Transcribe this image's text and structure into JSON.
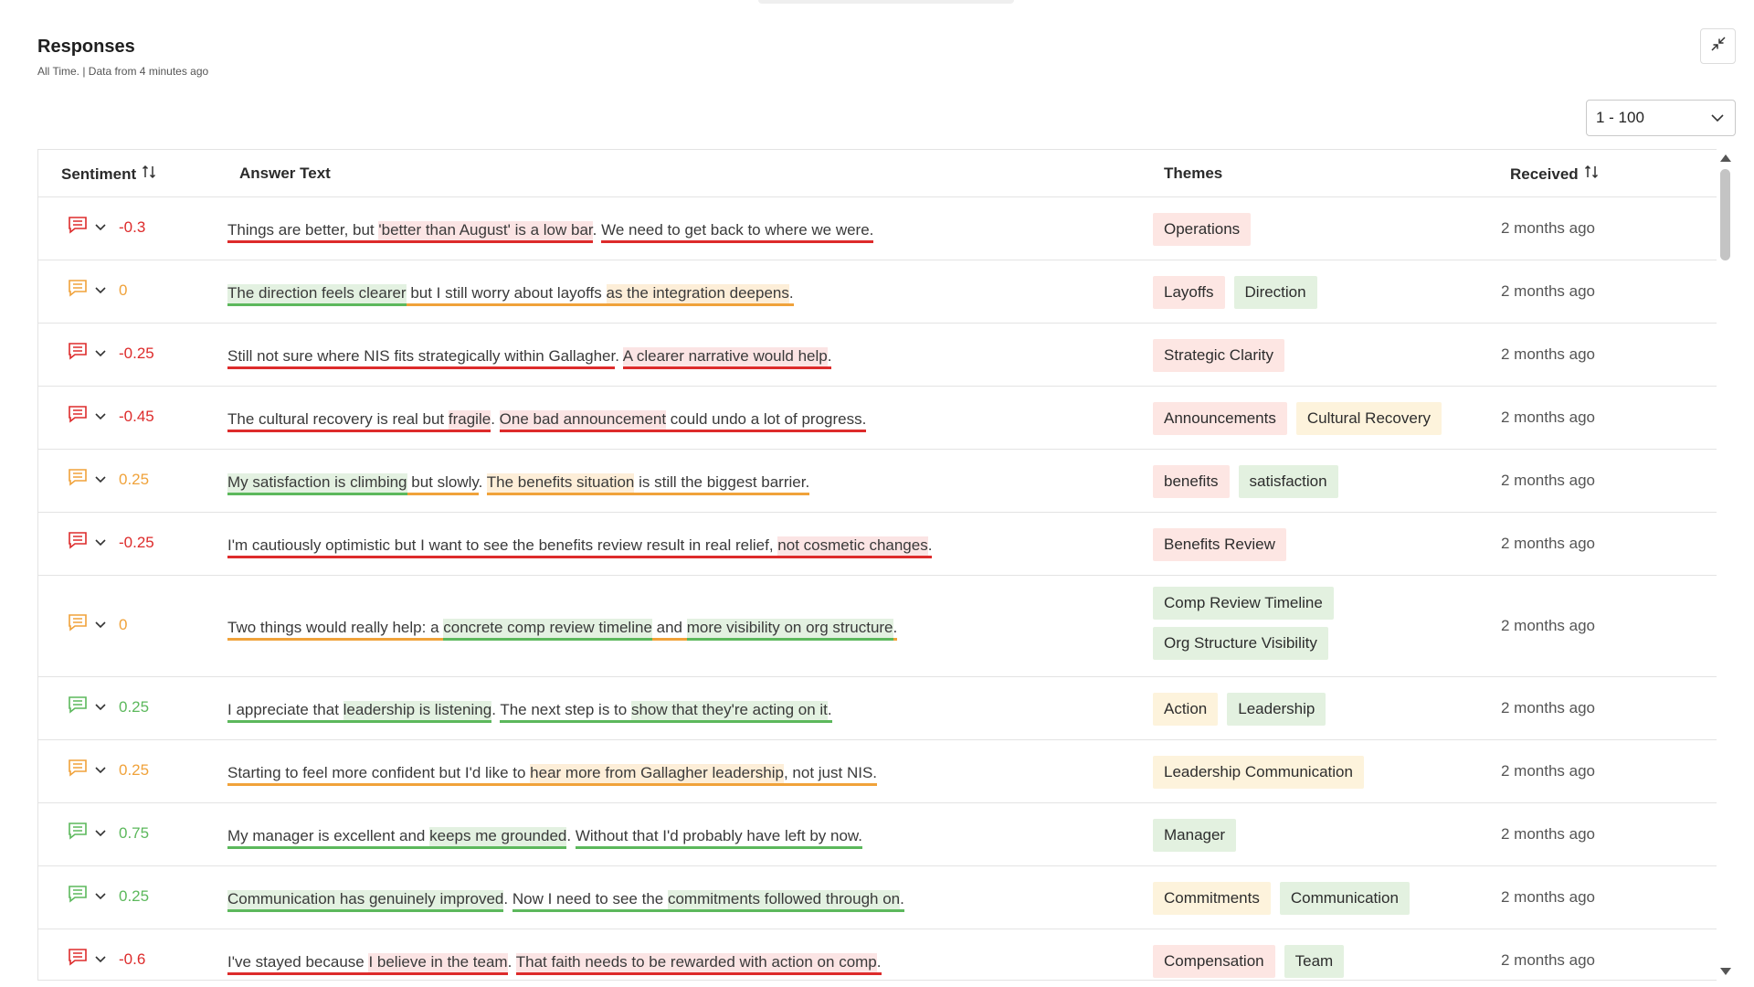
{
  "header": {
    "title": "Responses",
    "subtitle": "All Time. | Data from 4 minutes ago",
    "collapse_icon": "collapse-arrows-icon"
  },
  "pagination": {
    "selected": "1 - 100"
  },
  "colors": {
    "negative": "#dd2b2b",
    "positive": "#5cb85c",
    "neutral": "#f0a23a"
  },
  "columns": {
    "sentiment": "Sentiment",
    "answer": "Answer Text",
    "themes": "Themes",
    "received": "Received"
  },
  "rows": [
    {
      "score": "-0.3",
      "tone": "neg",
      "segments": [
        {
          "text": "Things are better, but ",
          "tone": "neg"
        },
        {
          "text": "'better than August' is a low bar",
          "tone": "neg",
          "hl": true
        },
        {
          "text": ". ",
          "tone": ""
        },
        {
          "text": "We need to get back to where we were",
          "tone": "neg"
        },
        {
          "text": ".",
          "tone": "neg"
        }
      ],
      "themes": [
        {
          "label": "Operations",
          "tone": "neg"
        }
      ],
      "received": "2 months ago"
    },
    {
      "score": "0",
      "tone": "neu",
      "segments": [
        {
          "text": "The direction feels clearer",
          "tone": "pos",
          "hl": true
        },
        {
          "text": " but I still worry about layoffs ",
          "tone": "neu"
        },
        {
          "text": "as the integration deepens",
          "tone": "neu",
          "hl": true
        },
        {
          "text": ".",
          "tone": "neu"
        }
      ],
      "themes": [
        {
          "label": "Layoffs",
          "tone": "neg"
        },
        {
          "label": "Direction",
          "tone": "pos"
        }
      ],
      "received": "2 months ago"
    },
    {
      "score": "-0.25",
      "tone": "neg",
      "segments": [
        {
          "text": "Still not sure where NIS fits strategically within Gallagher",
          "tone": "neg"
        },
        {
          "text": ". ",
          "tone": ""
        },
        {
          "text": "A clearer narrative would help",
          "tone": "neg",
          "hl": true
        },
        {
          "text": ".",
          "tone": "neg"
        }
      ],
      "themes": [
        {
          "label": "Strategic Clarity",
          "tone": "neg"
        }
      ],
      "received": "2 months ago"
    },
    {
      "score": "-0.45",
      "tone": "neg",
      "segments": [
        {
          "text": "The cultural recovery is real but ",
          "tone": "neg"
        },
        {
          "text": "fragile",
          "tone": "neg",
          "hl": true
        },
        {
          "text": ". ",
          "tone": ""
        },
        {
          "text": "One bad announcement",
          "tone": "neg",
          "hl": true
        },
        {
          "text": " could undo a lot of progress.",
          "tone": "neg"
        }
      ],
      "themes": [
        {
          "label": "Announcements",
          "tone": "neg"
        },
        {
          "label": "Cultural Recovery",
          "tone": "neu"
        }
      ],
      "received": "2 months ago"
    },
    {
      "score": "0.25",
      "tone": "neu",
      "segments": [
        {
          "text": "My satisfaction is climbing",
          "tone": "pos",
          "hl": true
        },
        {
          "text": " but slowly",
          "tone": "neu"
        },
        {
          "text": ". ",
          "tone": ""
        },
        {
          "text": "The benefits situation",
          "tone": "neu",
          "hl": true
        },
        {
          "text": " is still the biggest barrier.",
          "tone": "neu"
        }
      ],
      "themes": [
        {
          "label": "benefits",
          "tone": "neg"
        },
        {
          "label": "satisfaction",
          "tone": "pos"
        }
      ],
      "received": "2 months ago"
    },
    {
      "score": "-0.25",
      "tone": "neg",
      "segments": [
        {
          "text": "I'm cautiously optimistic but I want to see the benefits review result in real relief, ",
          "tone": "neg"
        },
        {
          "text": "not cosmetic changes",
          "tone": "neg",
          "hl": true
        },
        {
          "text": ".",
          "tone": "neg"
        }
      ],
      "themes": [
        {
          "label": "Benefits Review",
          "tone": "neg"
        }
      ],
      "received": "2 months ago"
    },
    {
      "score": "0",
      "tone": "neu",
      "segments": [
        {
          "text": "Two things would really help: a ",
          "tone": "neu"
        },
        {
          "text": "concrete comp review timeline",
          "tone": "pos",
          "hl": true
        },
        {
          "text": " and ",
          "tone": "neu"
        },
        {
          "text": "more visibility on org structure",
          "tone": "pos",
          "hl": true
        },
        {
          "text": ".",
          "tone": "neu"
        }
      ],
      "themes": [
        {
          "label": "Comp Review Timeline",
          "tone": "pos"
        },
        {
          "label": "Org Structure Visibility",
          "tone": "pos"
        }
      ],
      "received": "2 months ago"
    },
    {
      "score": "0.25",
      "tone": "pos",
      "segments": [
        {
          "text": "I appreciate that ",
          "tone": "pos"
        },
        {
          "text": "leadership is listening",
          "tone": "pos",
          "hl": true
        },
        {
          "text": ". ",
          "tone": ""
        },
        {
          "text": "The next step is to ",
          "tone": "pos"
        },
        {
          "text": "show that they're acting on it",
          "tone": "pos",
          "hl": true
        },
        {
          "text": ".",
          "tone": "pos"
        }
      ],
      "themes": [
        {
          "label": "Action",
          "tone": "neu"
        },
        {
          "label": "Leadership",
          "tone": "pos"
        }
      ],
      "received": "2 months ago"
    },
    {
      "score": "0.25",
      "tone": "neu",
      "segments": [
        {
          "text": "Starting to feel more confident but I'd like to ",
          "tone": "neu"
        },
        {
          "text": "hear more from Gallagher leadership",
          "tone": "neu",
          "hl": true
        },
        {
          "text": ", not just NIS.",
          "tone": "neu"
        }
      ],
      "themes": [
        {
          "label": "Leadership Communication",
          "tone": "neu"
        }
      ],
      "received": "2 months ago"
    },
    {
      "score": "0.75",
      "tone": "pos",
      "segments": [
        {
          "text": "My manager is excellent and ",
          "tone": "pos"
        },
        {
          "text": "keeps me grounded",
          "tone": "pos",
          "hl": true
        },
        {
          "text": ". ",
          "tone": ""
        },
        {
          "text": "Without that I'd probably have left by now.",
          "tone": "pos"
        }
      ],
      "themes": [
        {
          "label": "Manager",
          "tone": "pos"
        }
      ],
      "received": "2 months ago"
    },
    {
      "score": "0.25",
      "tone": "pos",
      "segments": [
        {
          "text": "Communication has genuinely improved",
          "tone": "pos",
          "hl": true
        },
        {
          "text": ". ",
          "tone": ""
        },
        {
          "text": "Now I need to see the ",
          "tone": "pos"
        },
        {
          "text": "commitments followed through on",
          "tone": "pos",
          "hl": true
        },
        {
          "text": ".",
          "tone": "pos"
        }
      ],
      "themes": [
        {
          "label": "Commitments",
          "tone": "neu"
        },
        {
          "label": "Communication",
          "tone": "pos"
        }
      ],
      "received": "2 months ago"
    },
    {
      "score": "-0.6",
      "tone": "neg",
      "segments": [
        {
          "text": "I've stayed because ",
          "tone": "neg"
        },
        {
          "text": "I believe in the team",
          "tone": "neg",
          "hl": true
        },
        {
          "text": ". ",
          "tone": ""
        },
        {
          "text": "That faith needs to be rewarded with action on comp",
          "tone": "neg",
          "hl": true
        },
        {
          "text": ".",
          "tone": "neg"
        }
      ],
      "themes": [
        {
          "label": "Compensation",
          "tone": "neg"
        },
        {
          "label": "Team",
          "tone": "pos"
        }
      ],
      "received": "2 months ago"
    }
  ]
}
